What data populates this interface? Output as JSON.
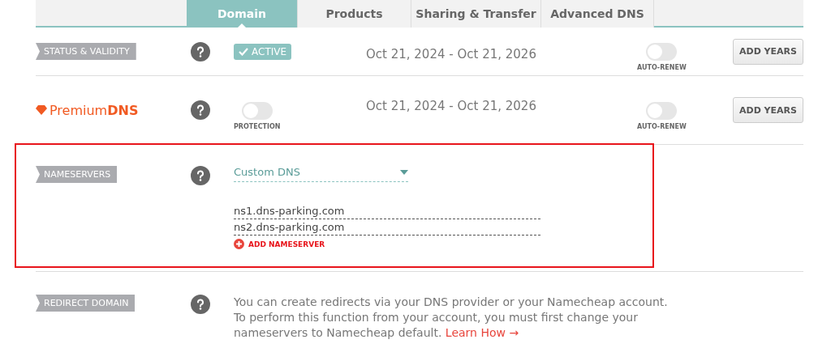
{
  "tabs": [
    {
      "label": "Domain",
      "selected": true
    },
    {
      "label": "Products",
      "selected": false
    },
    {
      "label": "Sharing & Transfer",
      "selected": false
    },
    {
      "label": "Advanced DNS",
      "selected": false
    }
  ],
  "status_row": {
    "label": "STATUS & VALIDITY",
    "badge": "ACTIVE",
    "dates": "Oct 21, 2024 - Oct 21, 2026",
    "auto_renew": {
      "label": "AUTO-RENEW",
      "on": false
    },
    "button": "ADD YEARS"
  },
  "premium_row": {
    "logo": "Premium**DNS**",
    "protection": {
      "label": "PROTECTION",
      "on": false
    },
    "dates": "Oct 21, 2024 - Oct 21, 2026",
    "auto_renew": {
      "label": "AUTO-RENEW",
      "on": false
    },
    "button": "ADD YEARS"
  },
  "nameservers": {
    "label": "NAMESERVERS",
    "highlighted": true,
    "dropdown": "Custom DNS",
    "servers": [
      "ns1.dns-parking.com",
      "ns2.dns-parking.com"
    ],
    "add_button": "ADD NAMESERVER"
  },
  "redirect": {
    "label": "REDIRECT DOMAIN",
    "text": "You can create redirects via your DNS provider or your Namecheap account. To perform this function from your account, you must first change your nameservers to Namecheap default.",
    "link": "Learn How →"
  }
}
